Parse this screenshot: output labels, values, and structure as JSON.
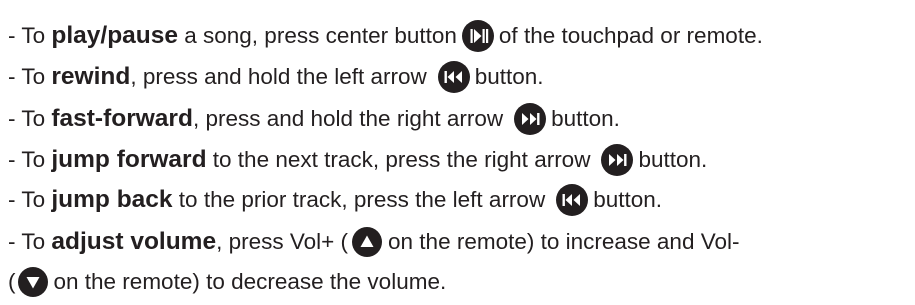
{
  "lines": [
    {
      "a": "- To ",
      "b": "play/pause",
      "c": " a song, press center button",
      "d": "of the touchpad or remote.",
      "icon": "play-pause-icon"
    },
    {
      "a": "- To ",
      "b": "rewind",
      "c": ", press and hold the left arrow",
      "d": "button.",
      "icon": "rewind-icon"
    },
    {
      "a": "- To ",
      "b": "fast-forward",
      "c": ", press and hold the right arrow",
      "d": "button.",
      "icon": "fast-forward-icon"
    },
    {
      "a": "- To ",
      "b": "jump forward",
      "c": " to the next track, press the right arrow",
      "d": "button.",
      "icon": "fast-forward-icon"
    },
    {
      "a": "- To ",
      "b": "jump back",
      "c": " to the prior track, press the left arrow",
      "d": "button.",
      "icon": "rewind-icon"
    },
    {
      "a": "- To ",
      "b": "adjust volume",
      "c": ", press Vol+ (",
      "d": "on the remote) to increase and Vol-",
      "icon": "volume-up-icon"
    },
    {
      "a": "(",
      "d": "on the remote) to decrease the volume.",
      "icon": "volume-down-icon"
    }
  ]
}
